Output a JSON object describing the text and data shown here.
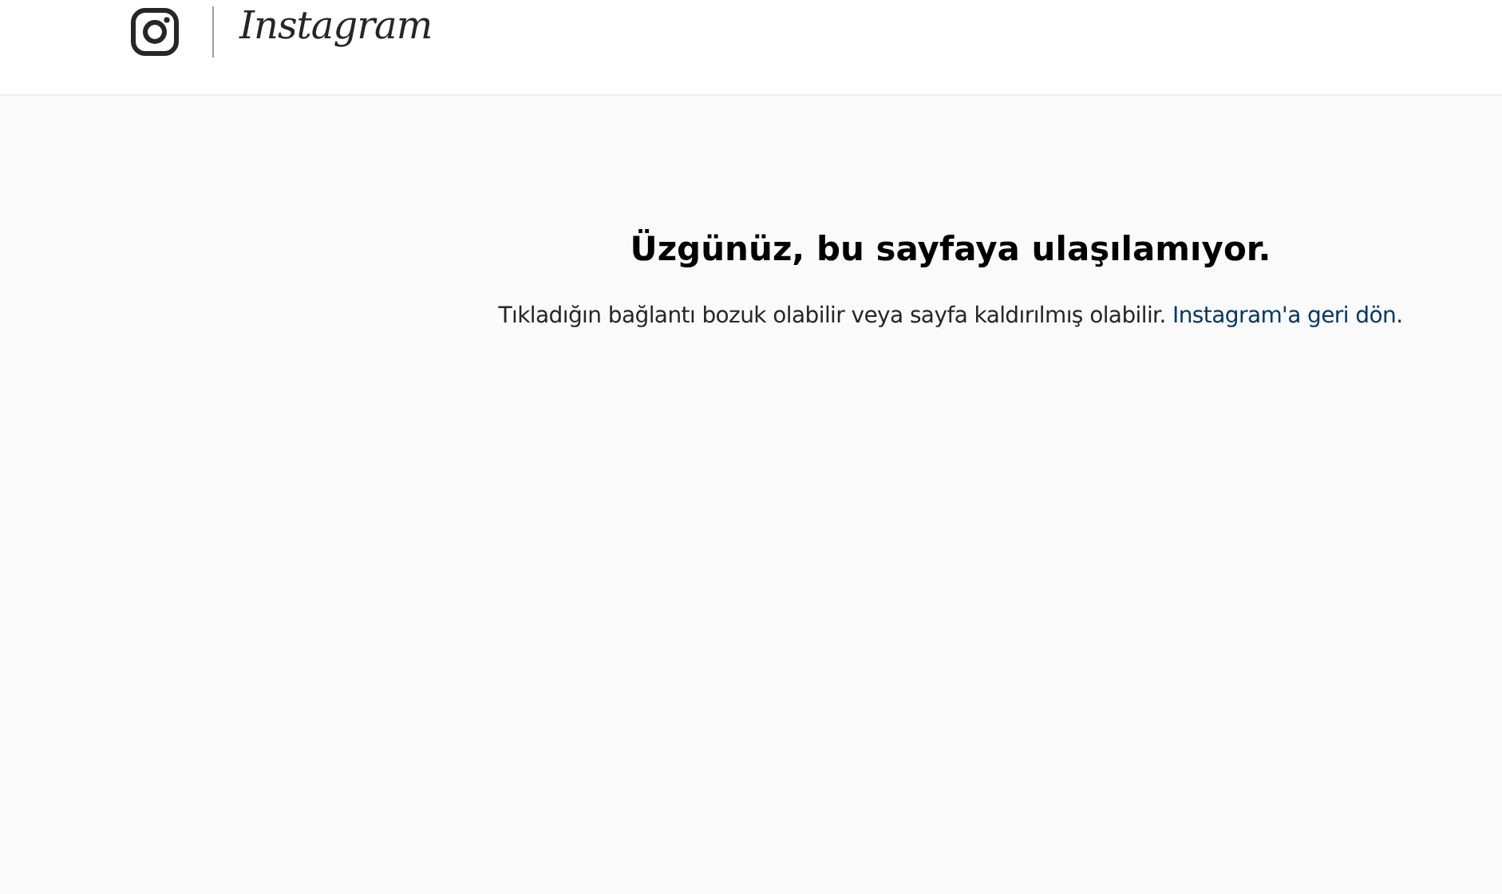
{
  "header": {
    "wordmark": "Instagram"
  },
  "error": {
    "title": "Üzgünüz, bu sayfaya ulaşılamıyor.",
    "message": "Tıkladığın bağlantı bozuk olabilir veya sayfa kaldırılmış olabilir.",
    "link": "Instagram'a geri dön",
    "suffix": "."
  }
}
